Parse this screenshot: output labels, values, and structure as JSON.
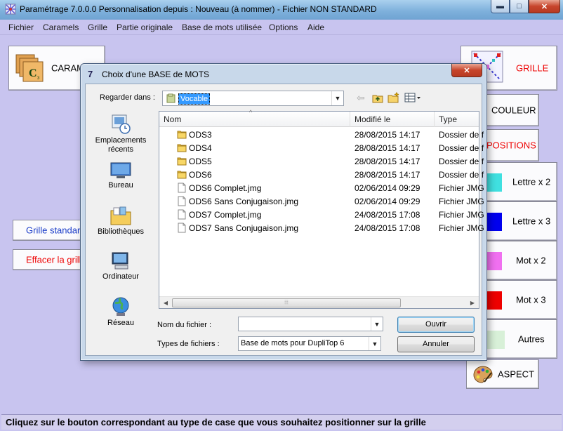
{
  "window": {
    "title": "Paramétrage 7.0.0.0  Personnalisation depuis :  Nouveau (à nommer) - Fichier NON STANDARD",
    "icon": "grid-star-icon",
    "controls": {
      "minimize": "▬",
      "maximize": "□",
      "close": "✕"
    }
  },
  "menu": [
    "Fichier",
    "Caramels",
    "Grille",
    "Partie originale",
    "Base de mots utilisée",
    "Options",
    "Aide"
  ],
  "panel": {
    "caramels_label": "CARAM",
    "grille_label": "GRILLE",
    "couleur_label": "COULEUR",
    "positions_label": "POSITIONS",
    "lettre2_label": "Lettre x 2",
    "lettre3_label": "Lettre x 3",
    "mot2_label": "Mot x 2",
    "mot3_label": "Mot x 3",
    "autres_label": "Autres",
    "aspect_label": "ASPECT",
    "grille_standard_label": "Grille standar",
    "effacer_label": "Effacer la grill",
    "colors": {
      "lettre2": "#40e0e0",
      "lettre3": "#0000ee",
      "mot2": "#f070f0",
      "mot3": "#ee0000",
      "autres": "#d8f0d8",
      "red_text": "#ee0000"
    }
  },
  "status": "Cliquez sur le bouton correspondant au type de case que vous souhaitez positionner sur la grille",
  "dialog": {
    "badge": "7",
    "title": "Choix d'une BASE de MOTS",
    "look_in_label": "Regarder dans :",
    "look_in_value": "Vocable",
    "places": [
      "Emplacements récents",
      "Bureau",
      "Bibliothèques",
      "Ordinateur",
      "Réseau"
    ],
    "columns": {
      "name": "Nom",
      "modified": "Modifié le",
      "type": "Type"
    },
    "files": [
      {
        "name": "ODS3",
        "modified": "28/08/2015 14:17",
        "type": "Dossier de f",
        "kind": "folder"
      },
      {
        "name": "ODS4",
        "modified": "28/08/2015 14:17",
        "type": "Dossier de f",
        "kind": "folder"
      },
      {
        "name": "ODS5",
        "modified": "28/08/2015 14:17",
        "type": "Dossier de f",
        "kind": "folder"
      },
      {
        "name": "ODS6",
        "modified": "28/08/2015 14:17",
        "type": "Dossier de f",
        "kind": "folder"
      },
      {
        "name": "ODS6 Complet.jmg",
        "modified": "02/06/2014 09:29",
        "type": "Fichier JMG",
        "kind": "file"
      },
      {
        "name": "ODS6 Sans Conjugaison.jmg",
        "modified": "02/06/2014 09:29",
        "type": "Fichier JMG",
        "kind": "file"
      },
      {
        "name": "ODS7 Complet.jmg",
        "modified": "24/08/2015 17:08",
        "type": "Fichier JMG",
        "kind": "file"
      },
      {
        "name": "ODS7 Sans Conjugaison.jmg",
        "modified": "24/08/2015 17:08",
        "type": "Fichier JMG",
        "kind": "file"
      }
    ],
    "filename_label": "Nom du fichier :",
    "filename_value": "",
    "filetype_label": "Types de fichiers :",
    "filetype_value": "Base de mots pour DupliTop 6",
    "open_label": "Ouvrir",
    "cancel_label": "Annuler"
  }
}
